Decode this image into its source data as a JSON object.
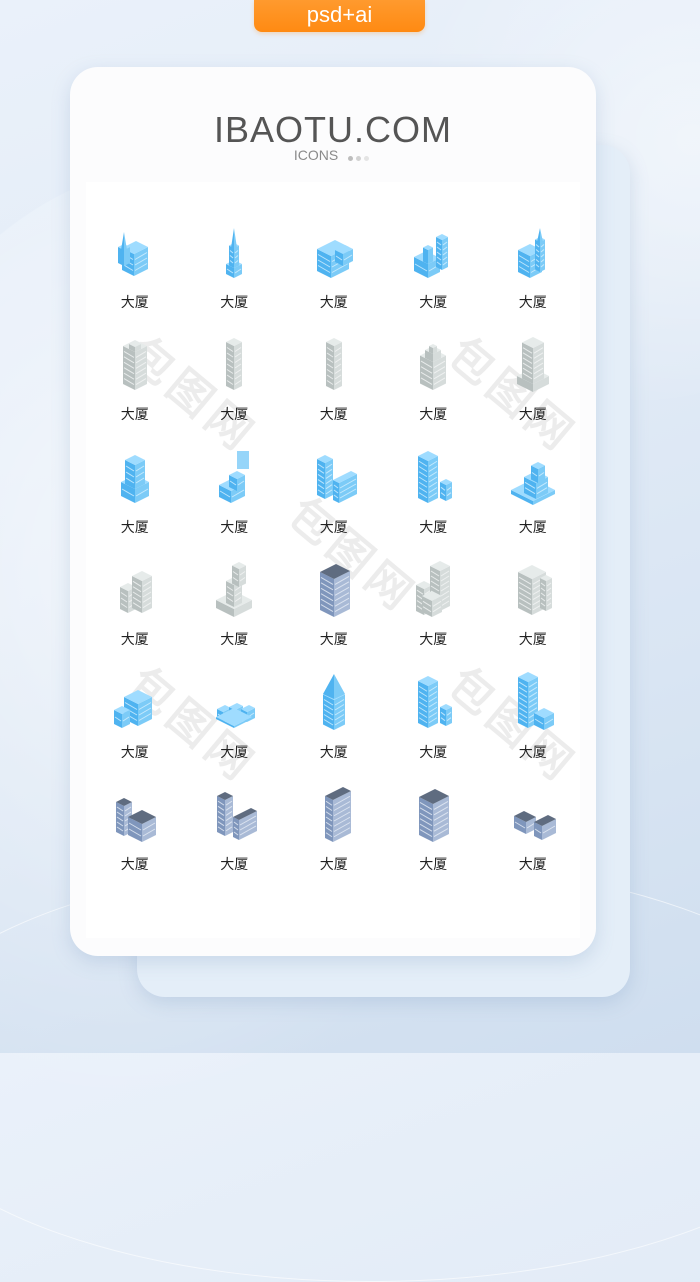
{
  "badge": {
    "label": "psd+ai"
  },
  "header": {
    "title": "IBAOTU.COM",
    "subtitle": "ICONS"
  },
  "colors": {
    "badge": "#ff8f1c",
    "title": "#555555",
    "blue_top": "#9fdcff",
    "blue_left": "#4fb3f0",
    "blue_right": "#7ccbf7",
    "gray_top": "#e6ebea",
    "gray_left": "#b8c0bf",
    "gray_right": "#d6dcdb",
    "slate_top": "#5f6c80",
    "slate_left": "#7f96bc",
    "slate_right": "#a9bad6"
  },
  "watermark": {
    "text": "包图网"
  },
  "icons": [
    {
      "label": "大厦",
      "style": "blue",
      "shape": "church"
    },
    {
      "label": "大厦",
      "style": "blue",
      "shape": "spire-tower"
    },
    {
      "label": "大厦",
      "style": "blue",
      "shape": "wide-block"
    },
    {
      "label": "大厦",
      "style": "blue",
      "shape": "stepped-complex"
    },
    {
      "label": "大厦",
      "style": "blue",
      "shape": "cathedral-tower"
    },
    {
      "label": "大厦",
      "style": "gray",
      "shape": "tower-crown"
    },
    {
      "label": "大厦",
      "style": "gray",
      "shape": "slim-tower"
    },
    {
      "label": "大厦",
      "style": "gray",
      "shape": "slim-tower"
    },
    {
      "label": "大厦",
      "style": "gray",
      "shape": "tiered-tower"
    },
    {
      "label": "大厦",
      "style": "gray",
      "shape": "grid-tower"
    },
    {
      "label": "大厦",
      "style": "blue",
      "shape": "round-tower"
    },
    {
      "label": "大厦",
      "style": "blue",
      "shape": "billboard-building"
    },
    {
      "label": "大厦",
      "style": "blue",
      "shape": "l-building"
    },
    {
      "label": "大厦",
      "style": "blue",
      "shape": "block-annex"
    },
    {
      "label": "大厦",
      "style": "blue",
      "shape": "pyramid-stack"
    },
    {
      "label": "大厦",
      "style": "gray",
      "shape": "twin-block"
    },
    {
      "label": "大厦",
      "style": "gray",
      "shape": "stepped-tower"
    },
    {
      "label": "大厦",
      "style": "slate",
      "shape": "office-block"
    },
    {
      "label": "大厦",
      "style": "gray",
      "shape": "cluster"
    },
    {
      "label": "大厦",
      "style": "gray",
      "shape": "wide-tower"
    },
    {
      "label": "大厦",
      "style": "blue",
      "shape": "house"
    },
    {
      "label": "大厦",
      "style": "blue",
      "shape": "row-houses"
    },
    {
      "label": "大厦",
      "style": "blue",
      "shape": "pyramid-top"
    },
    {
      "label": "大厦",
      "style": "blue",
      "shape": "block-annex"
    },
    {
      "label": "大厦",
      "style": "blue",
      "shape": "terrace-tower"
    },
    {
      "label": "大厦",
      "style": "slate",
      "shape": "factory"
    },
    {
      "label": "大厦",
      "style": "slate",
      "shape": "l-building"
    },
    {
      "label": "大厦",
      "style": "slate",
      "shape": "curved-block"
    },
    {
      "label": "大厦",
      "style": "slate",
      "shape": "office-block"
    },
    {
      "label": "大厦",
      "style": "slate",
      "shape": "low-wide"
    }
  ]
}
